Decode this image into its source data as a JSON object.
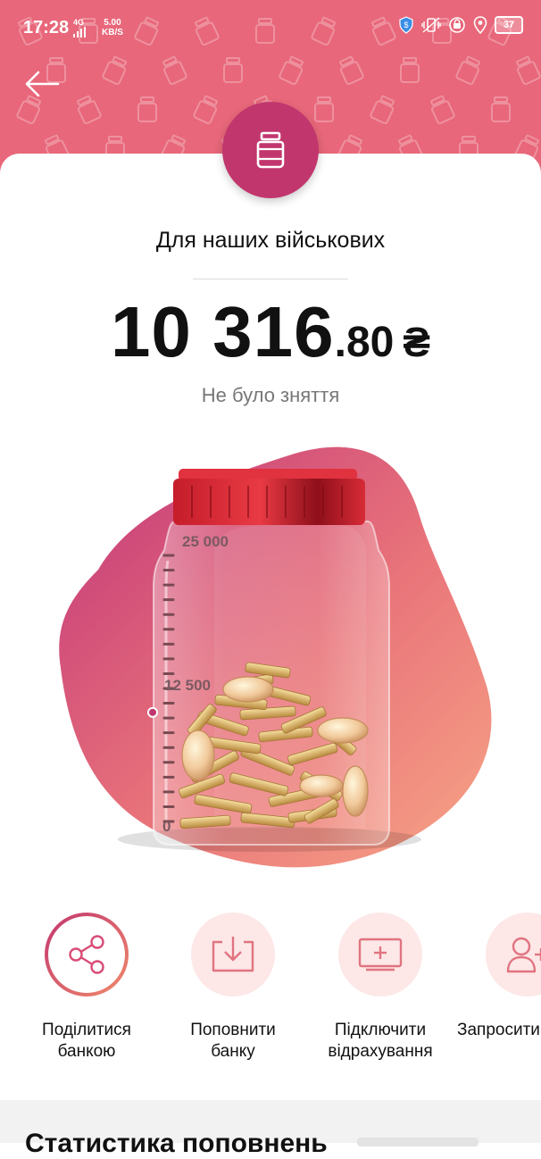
{
  "status_bar": {
    "time": "17:28",
    "network": "4G",
    "speed_value": "5.00",
    "speed_unit": "KB/S",
    "battery": "37"
  },
  "jar": {
    "title": "Для наших військових",
    "amount_integer": "10 316",
    "amount_decimal": ".80",
    "currency": "₴",
    "withdrawal_status": "Не було зняття",
    "goal_label": "25 000",
    "mid_label": "12 500",
    "zero_label": "0",
    "fill_fraction": 0.41
  },
  "actions": [
    {
      "label": "Поділитися\nбанкою",
      "icon": "share-icon"
    },
    {
      "label": "Поповнити\nбанку",
      "icon": "top-up-icon"
    },
    {
      "label": "Підключити\nвідрахування",
      "icon": "deduction-icon"
    },
    {
      "label": "Запросити",
      "icon": "invite-user-icon"
    }
  ],
  "stats": {
    "title": "Статистика поповнень"
  },
  "colors": {
    "header": "#e8677a",
    "accent": "#c2366e",
    "action_bg": "#fde7e7"
  }
}
